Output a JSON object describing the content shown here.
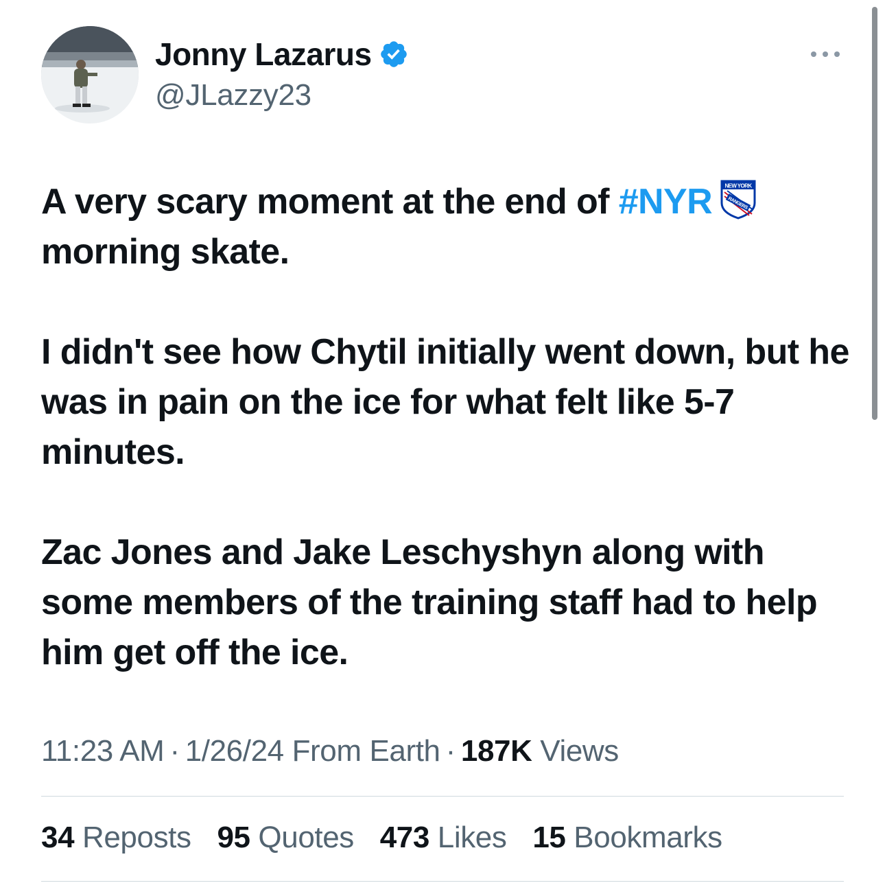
{
  "author": {
    "display_name": "Jonny Lazarus",
    "handle": "@JLazzy23",
    "verified": true,
    "verified_icon": "verified-badge-icon"
  },
  "menu": {
    "more_icon": "more-dots-icon"
  },
  "tweet": {
    "line1_prefix": "A very scary moment at the end of ",
    "hashtag": "#NYR",
    "emoji_icon": "new-york-rangers-logo-icon",
    "line1_suffix": "morning skate.",
    "paragraph2": "I didn't see how Chytil initially went down, but he was in pain on the ice for what felt like 5-7 minutes.",
    "paragraph3": "Zac Jones and Jake Leschyshyn along with some members of the training staff had to help him get off the ice."
  },
  "meta": {
    "time": "11:23 AM",
    "separator": "·",
    "date": "1/26/24",
    "source": "From Earth",
    "views_count": "187K",
    "views_label": "Views"
  },
  "stats": [
    {
      "count": "34",
      "label": "Reposts"
    },
    {
      "count": "95",
      "label": "Quotes"
    },
    {
      "count": "473",
      "label": "Likes"
    },
    {
      "count": "15",
      "label": "Bookmarks"
    }
  ],
  "colors": {
    "text_primary": "#0f1419",
    "text_secondary": "#536471",
    "accent": "#1d9bf0",
    "divider": "#cfd9de"
  }
}
